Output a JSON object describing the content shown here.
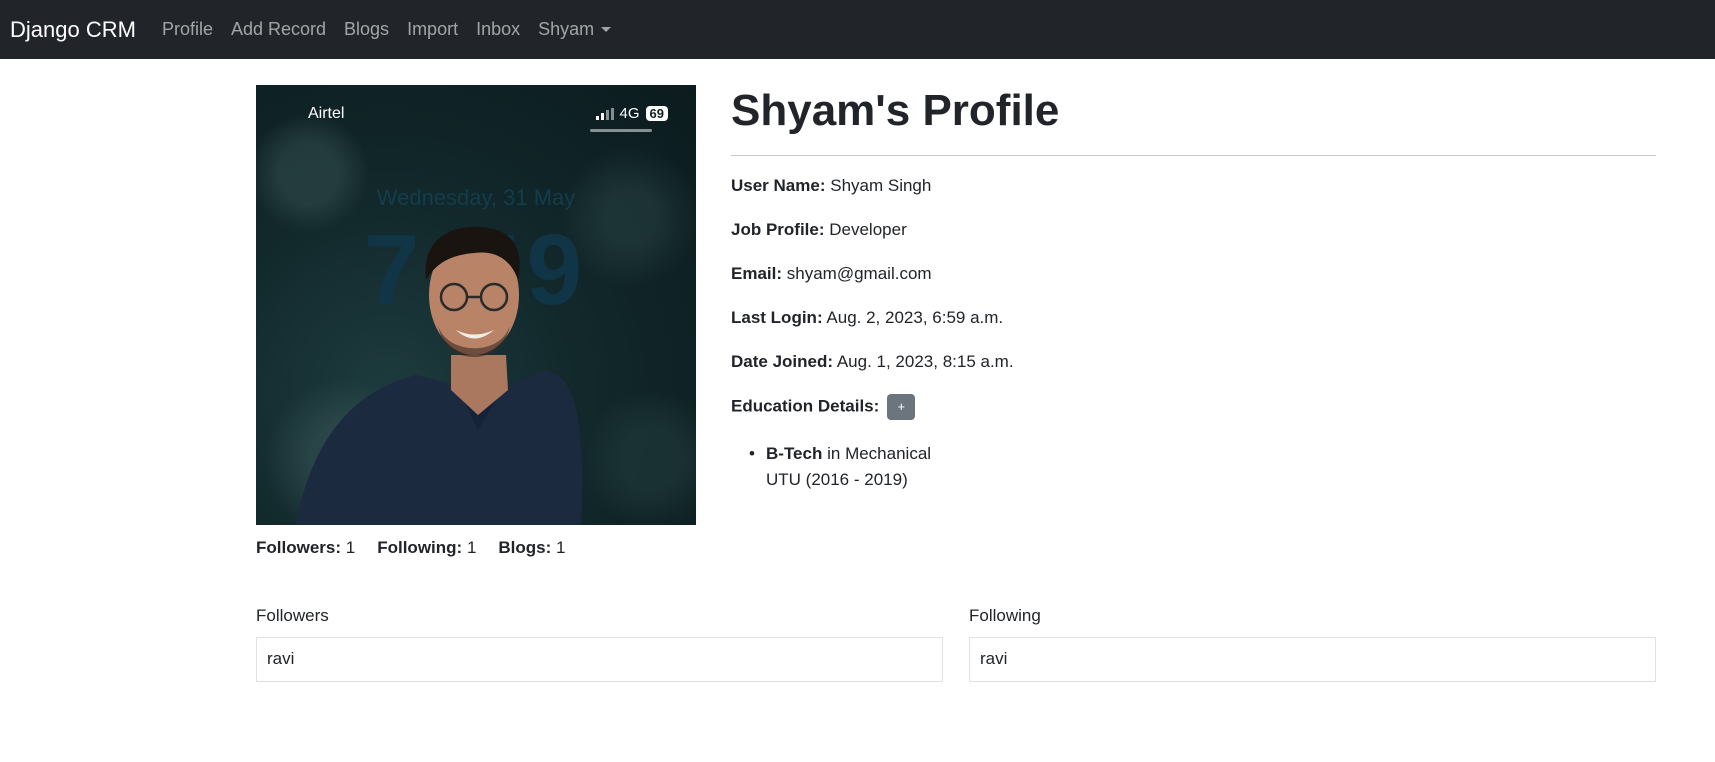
{
  "navbar": {
    "brand": "Django CRM",
    "links": [
      "Profile",
      "Add Record",
      "Blogs",
      "Import",
      "Inbox"
    ],
    "user_menu": "Shyam"
  },
  "photo": {
    "carrier": "Airtel",
    "network": "4G",
    "battery": "69",
    "lock_date": "Wednesday, 31 May",
    "lock_time": "7:59"
  },
  "stats": {
    "followers_label": "Followers:",
    "followers_count": "1",
    "following_label": "Following:",
    "following_count": "1",
    "blogs_label": "Blogs:",
    "blogs_count": "1"
  },
  "profile": {
    "title": "Shyam's Profile",
    "fields": [
      {
        "label": "User Name:",
        "value": "Shyam Singh"
      },
      {
        "label": "Job Profile:",
        "value": "Developer"
      },
      {
        "label": "Email:",
        "value": "shyam@gmail.com"
      },
      {
        "label": "Last Login:",
        "value": "Aug. 2, 2023, 6:59 a.m."
      },
      {
        "label": "Date Joined:",
        "value": "Aug. 1, 2023, 8:15 a.m."
      }
    ],
    "education_label": "Education Details:",
    "add_education_label": "+",
    "education": [
      {
        "degree": "B-Tech",
        "in_text": "in",
        "field": "Mechanical",
        "institute": "UTU (2016 - 2019)"
      }
    ]
  },
  "followers": {
    "title": "Followers",
    "items": [
      "ravi"
    ]
  },
  "following": {
    "title": "Following",
    "items": [
      "ravi"
    ]
  },
  "colors": {
    "navbar_bg": "#212529",
    "button_secondary": "#6c757d"
  }
}
